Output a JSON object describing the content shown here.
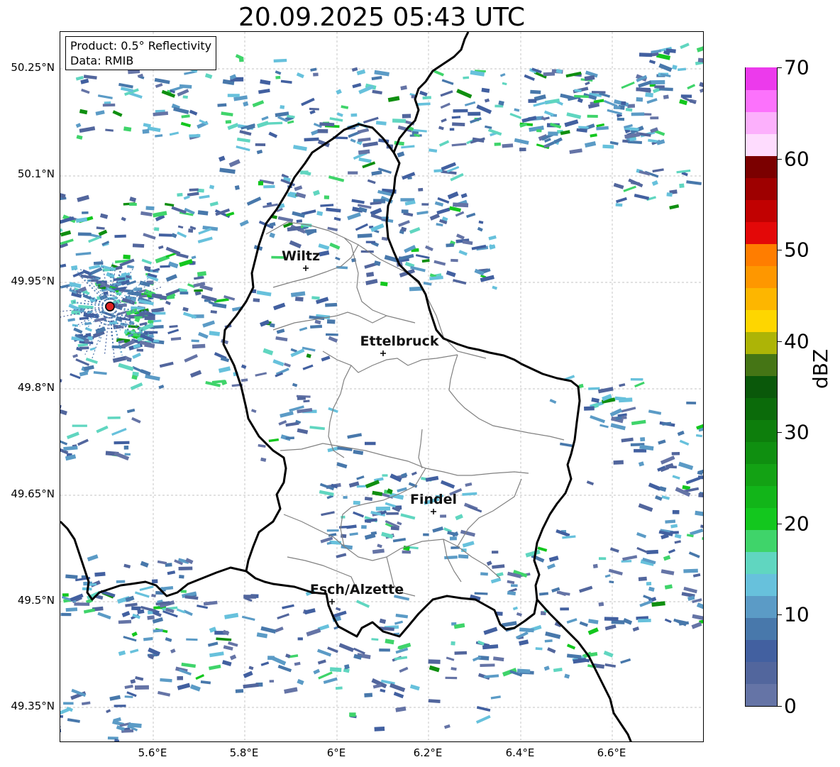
{
  "title": "20.09.2025 05:43 UTC",
  "info": {
    "product": "Product: 0.5° Reflectivity",
    "data": "Data: RMIB"
  },
  "axes": {
    "lat_labels": [
      "50.25°N",
      "50.1°N",
      "49.95°N",
      "49.8°N",
      "49.65°N",
      "49.5°N",
      "49.35°N"
    ],
    "lon_labels": [
      "5.6°E",
      "5.8°E",
      "6°E",
      "6.2°E",
      "6.4°E",
      "6.6°E"
    ]
  },
  "cities": [
    {
      "name": "Wiltz"
    },
    {
      "name": "Ettelbruck"
    },
    {
      "name": "Findel"
    },
    {
      "name": "Esch/Alzette"
    }
  ],
  "colorbar": {
    "unit": "dBZ",
    "tick_labels": [
      "0",
      "10",
      "20",
      "30",
      "40",
      "50",
      "60",
      "70"
    ],
    "colors": [
      "#6574a6",
      "#52669d",
      "#4260a0",
      "#4878ab",
      "#5b9bc6",
      "#67c1dc",
      "#60d6c0",
      "#3fd46a",
      "#13c71e",
      "#12b519",
      "#13a214",
      "#0f8f10",
      "#0d7e0c",
      "#0b6b0a",
      "#0a580a",
      "#457515",
      "#adb406",
      "#fed600",
      "#fdb600",
      "#fe9700",
      "#ff7d00",
      "#e30808",
      "#c10101",
      "#9e0000",
      "#7b0000",
      "#fedcfe",
      "#fcb0fc",
      "#fc72fc",
      "#ec3aec"
    ]
  },
  "colors": {
    "border": "#000000",
    "district": "#808080",
    "grid": "#b0b0b0",
    "radar_site": "#dd2222"
  }
}
